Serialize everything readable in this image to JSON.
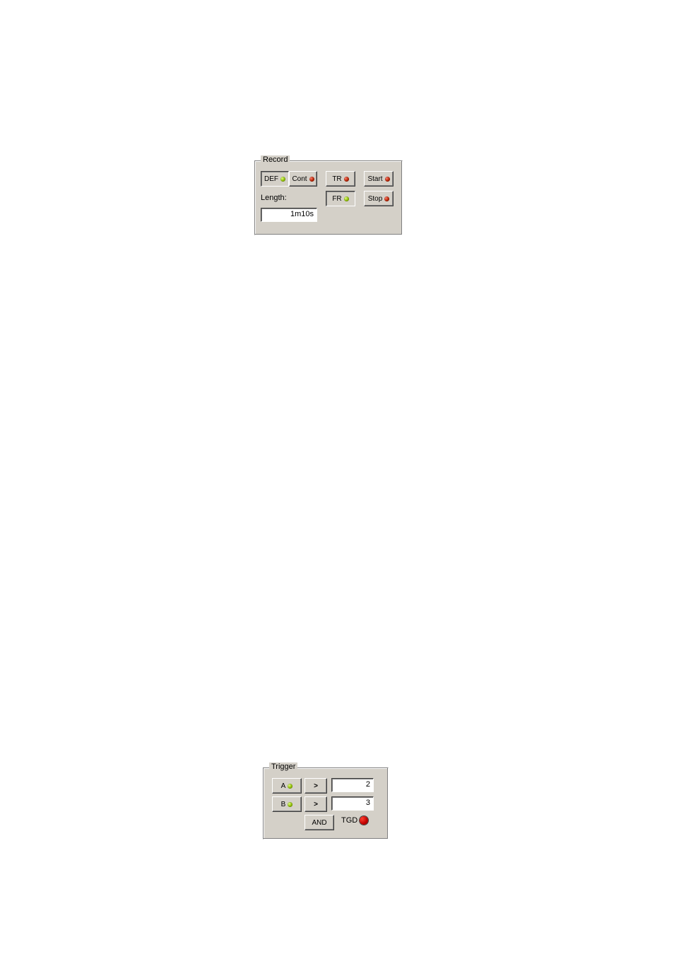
{
  "record": {
    "legend": "Record",
    "def_label": "DEF",
    "cont_label": "Cont",
    "tr_label": "TR",
    "fr_label": "FR",
    "start_label": "Start",
    "stop_label": "Stop",
    "length_label": "Length:",
    "length_value": "1m10s"
  },
  "trigger": {
    "legend": "Trigger",
    "a_label": "A",
    "b_label": "B",
    "a_op": ">",
    "b_op": ">",
    "a_value": "2",
    "b_value": "3",
    "logic_label": "AND",
    "tgd_label": "TGD"
  }
}
